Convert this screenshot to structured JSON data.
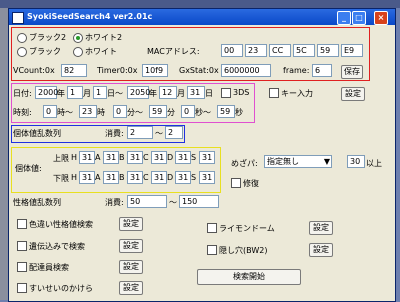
{
  "window": {
    "title": "SyokiSeedSearch4 ver2.01c"
  },
  "rom": {
    "options": [
      "ブラック2",
      "ホワイト2",
      "ブラック",
      "ホワイト"
    ]
  },
  "mac": {
    "label": "MACアドレス:",
    "fields": [
      "00",
      "23",
      "CC",
      "5C",
      "59",
      "E9"
    ]
  },
  "params": {
    "vcount_label": "VCount:0x",
    "vcount_value": "82",
    "timer_label": "Timer0:0x",
    "timer_value": "10f9",
    "gx_label": "GxStat:0x",
    "gx_value": "6000000",
    "frame_label": "frame:",
    "frame_value": "6",
    "save_label": "保存"
  },
  "date": {
    "label": "日付:",
    "start_year": "2000",
    "year_unit_1": "年",
    "start_month": "1",
    "month_unit_1": "月",
    "start_day": "1",
    "day_unit_1": "日",
    "tilde": "～",
    "end_year": "2050",
    "year_unit_2": "年",
    "end_month": "12",
    "month_unit_2": "月",
    "end_day": "31",
    "day_unit_2": "日",
    "ds_label": "3DS",
    "key_label": "キー入力",
    "settings_label": "設定"
  },
  "time": {
    "label": "時刻:",
    "h1": "0",
    "h_unit_1": "時～",
    "h2": "23",
    "h_unit_2": "時",
    "m1": "0",
    "m_unit_1": "分～",
    "m2": "59",
    "m_unit_2": "分",
    "s1": "0",
    "s_unit_1": "秒～",
    "s2": "59",
    "s_unit_2": "秒"
  },
  "iv_seq": {
    "label": "個体値乱数列",
    "consume_label": "消費:",
    "from": "2",
    "tilde": "～",
    "to": "2"
  },
  "iv": {
    "label": "個体値:",
    "upper_label": "上限",
    "lower_label": "下限",
    "stats": [
      "H",
      "A",
      "B",
      "C",
      "D",
      "S"
    ],
    "upper_values": [
      "31",
      "31",
      "31",
      "31",
      "31",
      "31"
    ],
    "lower_values": [
      "31",
      "31",
      "31",
      "31",
      "31",
      "31"
    ]
  },
  "nature": {
    "label": "めざパ:",
    "value": "指定無し",
    "power": "30",
    "power_suffix": "以上",
    "check_label": "修復"
  },
  "pid_seq": {
    "label": "性格値乱数列",
    "consume_label": "消費:",
    "from": "50",
    "tilde": "～",
    "to": "150"
  },
  "options": {
    "left": [
      {
        "label": "色違い性格値検索",
        "button": "設定"
      },
      {
        "label": "遺伝込みで検索",
        "button": "設定"
      },
      {
        "label": "配達員検索",
        "button": "設定"
      },
      {
        "label": "すいせいのかけら",
        "button": "設定"
      }
    ],
    "right": [
      {
        "label": "ライモンドーム",
        "button": "設定"
      },
      {
        "label": "隠し穴(BW2)",
        "button": "設定"
      }
    ]
  },
  "search_label": "検索開始"
}
